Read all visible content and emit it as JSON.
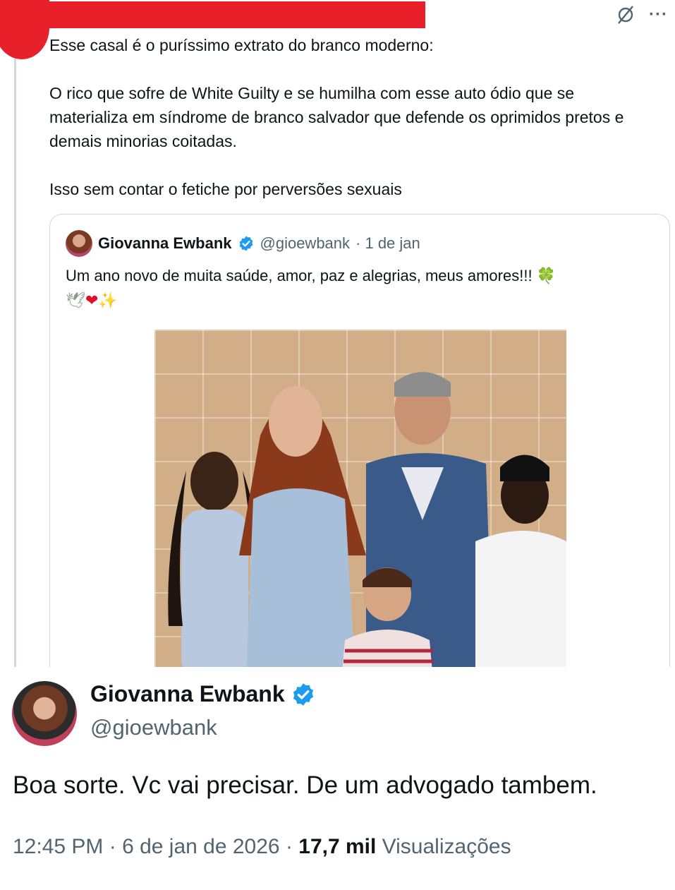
{
  "quoting_post": {
    "paragraphs": [
      "Esse casal é o puríssimo extrato do branco moderno:",
      "O rico que sofre de White Guilty e se humilha com esse auto ódio que se materializa em síndrome de branco salvador que defende os oprimidos pretos e demais minorias coitadas.",
      "Isso sem contar o fetiche por perversões sexuais"
    ],
    "icons": [
      "grok-icon",
      "more-icon"
    ],
    "more_label": "···"
  },
  "quoted_post": {
    "name": "Giovanna Ewbank",
    "handle": "@gioewbank",
    "date": "· 1 de jan",
    "text": "Um ano novo de muita saúde, amor, paz e alegrias, meus amores!!!",
    "emoji_clover": "🍀",
    "emoji_dove": "🕊",
    "emoji_heart": "❤",
    "emoji_sparkles": "✨"
  },
  "reply_post": {
    "name": "Giovanna Ewbank",
    "handle": "@gioewbank",
    "text": "Boa sorte. Vc vai precisar. De um advogado tambem.",
    "time": "12:45 PM · 6 de jan de 2026 · ",
    "views_count": "17,7 mil",
    "views_label": " Visualizações"
  },
  "colors": {
    "redaction": "#e8202a",
    "verified": "#1d9bf0",
    "text_primary": "#0f1419",
    "text_secondary": "#536471",
    "border": "#cfd9de"
  }
}
